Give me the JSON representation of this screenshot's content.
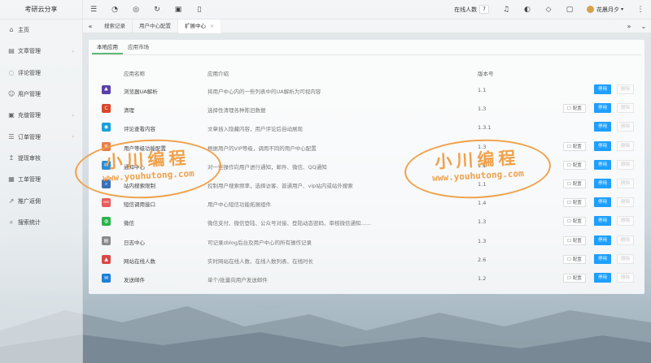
{
  "brand": "考研云分享",
  "sidebar": {
    "items": [
      {
        "label": "主页",
        "icon": "home-icon",
        "glyph": "⌂",
        "arrow": false
      },
      {
        "label": "文章管理",
        "icon": "article-icon",
        "glyph": "▤",
        "arrow": true
      },
      {
        "label": "评论管理",
        "icon": "comment-icon",
        "glyph": "◌",
        "arrow": false
      },
      {
        "label": "用户管理",
        "icon": "user-icon",
        "glyph": "☺",
        "arrow": false
      },
      {
        "label": "充值管理",
        "icon": "recharge-icon",
        "glyph": "▣",
        "arrow": true
      },
      {
        "label": "订单管理",
        "icon": "order-icon",
        "glyph": "☰",
        "arrow": true
      },
      {
        "label": "提现审核",
        "icon": "withdraw-icon",
        "glyph": "↥",
        "arrow": false
      },
      {
        "label": "工单管理",
        "icon": "ticket-icon",
        "glyph": "▦",
        "arrow": false
      },
      {
        "label": "推广返佣",
        "icon": "promotion-icon",
        "glyph": "↗",
        "arrow": false
      },
      {
        "label": "搜索统计",
        "icon": "search-stats-icon",
        "glyph": "⌕",
        "arrow": false
      }
    ]
  },
  "header": {
    "online_label": "在线人数",
    "online_count": "7",
    "username": "花晨月夕"
  },
  "tabs": [
    {
      "label": "搜索记录",
      "active": false,
      "closable": false
    },
    {
      "label": "用户中心配置",
      "active": false,
      "closable": false
    },
    {
      "label": "扩展中心",
      "active": true,
      "closable": true
    }
  ],
  "subtabs": {
    "local": "本地应用",
    "market": "应用市场"
  },
  "table": {
    "headers": {
      "name": "应用名称",
      "desc": "应用介绍",
      "version": "版本号"
    },
    "config_label": "配置",
    "stop_label": "停用",
    "delete_label": "删除",
    "rows": [
      {
        "name": "浏览器UA解析",
        "desc": "将用户中心内的一些列表中的UA解析为可视内容",
        "version": "1.1",
        "config": false,
        "icon_color": "#5a3fa8",
        "icon_glyph": "♣"
      },
      {
        "name": "清理",
        "desc": "选择性清理各种陈旧数据",
        "version": "1.3",
        "config": true,
        "icon_color": "#d9472b",
        "icon_glyph": "C"
      },
      {
        "name": "评论查看内容",
        "desc": "文章插入隐藏内容，用户评论后自动展现",
        "version": "1.3.1",
        "config": false,
        "icon_color": "#1aa0d8",
        "icon_glyph": "◉"
      },
      {
        "name": "用户等级功能配置",
        "desc": "根据用户的VIP等级，调用不同的用户中心配置",
        "version": "1.3",
        "config": true,
        "icon_color": "#e87d4a",
        "icon_glyph": "♛"
      },
      {
        "name": "通知中心",
        "desc": "对一些操作向用户进行通知，邮件、微信、QQ通知",
        "version": "1.1",
        "config": true,
        "icon_color": "#2a8fd6",
        "icon_glyph": "✉"
      },
      {
        "name": "站内搜索限制",
        "desc": "控制用户搜索频率，选择访客、普通用户、vip站内或站外搜索",
        "version": "1.1",
        "config": true,
        "icon_color": "#3b6fb6",
        "icon_glyph": "⌕"
      },
      {
        "name": "短信调用接口",
        "desc": "用户中心短信功能拓展组件",
        "version": "1.4",
        "config": true,
        "icon_color": "#e85c5c",
        "icon_glyph": "SMS"
      },
      {
        "name": "微信",
        "desc": "微信支付、微信登陆、公众号对接、登陆动态密码、审核微信通知......",
        "version": "1.3",
        "config": true,
        "icon_color": "#2bb24c",
        "icon_glyph": "◍"
      },
      {
        "name": "日志中心",
        "desc": "可记录zblog后台及用户中心的所有操作记录",
        "version": "1.3",
        "config": true,
        "icon_color": "#8a8a8a",
        "icon_glyph": "▤"
      },
      {
        "name": "网站在线人数",
        "desc": "实时网站在线人数、在线人数列表、在线时长",
        "version": "2.6",
        "config": true,
        "icon_color": "#d94848",
        "icon_glyph": "▲"
      },
      {
        "name": "发送邮件",
        "desc": "单个/批量向用户发送邮件",
        "version": "1.2",
        "config": true,
        "icon_color": "#1e7fd8",
        "icon_glyph": "✉"
      }
    ]
  },
  "watermark": {
    "title": "小川编程",
    "url": "www.youhutong.com"
  }
}
